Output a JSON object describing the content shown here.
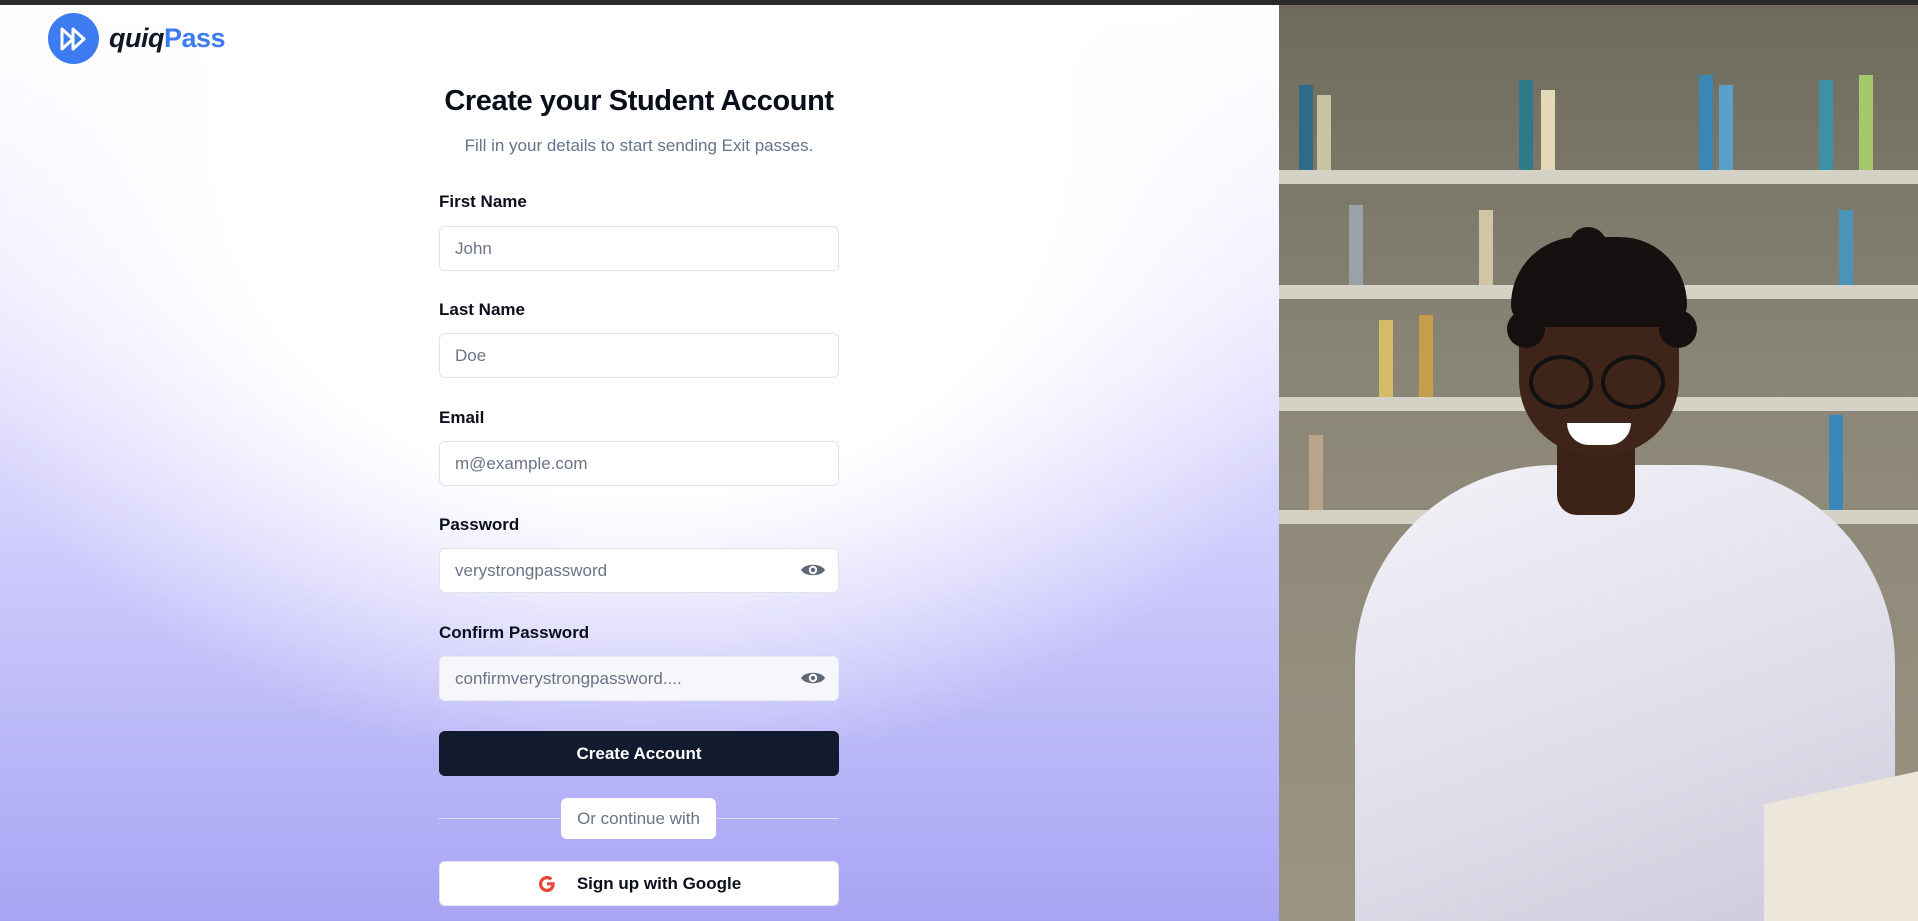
{
  "brand": {
    "name_part1": "quiq",
    "name_part2": "Pass",
    "accent_color": "#3d7bf0",
    "logo_icon": "fast-forward-icon"
  },
  "header": {
    "title": "Create your Student Account",
    "subtitle": "Fill in your details to start sending Exit passes."
  },
  "form": {
    "first_name": {
      "label": "First Name",
      "placeholder": "John",
      "value": ""
    },
    "last_name": {
      "label": "Last Name",
      "placeholder": "Doe",
      "value": ""
    },
    "email": {
      "label": "Email",
      "placeholder": "m@example.com",
      "value": ""
    },
    "password": {
      "label": "Password",
      "placeholder": "verystrongpassword",
      "value": "",
      "toggle_icon": "eye-icon"
    },
    "confirm_password": {
      "label": "Confirm Password",
      "placeholder": "confirmverystrongpassword....",
      "value": "",
      "toggle_icon": "eye-icon"
    },
    "submit_label": "Create Account",
    "divider_text": "Or continue with",
    "google_label": "Sign up with Google",
    "google_icon": "google-icon"
  },
  "hero_image": {
    "subject": "student-photo"
  },
  "colors": {
    "primary_button": "#121a2e",
    "placeholder": "#6b7486"
  }
}
